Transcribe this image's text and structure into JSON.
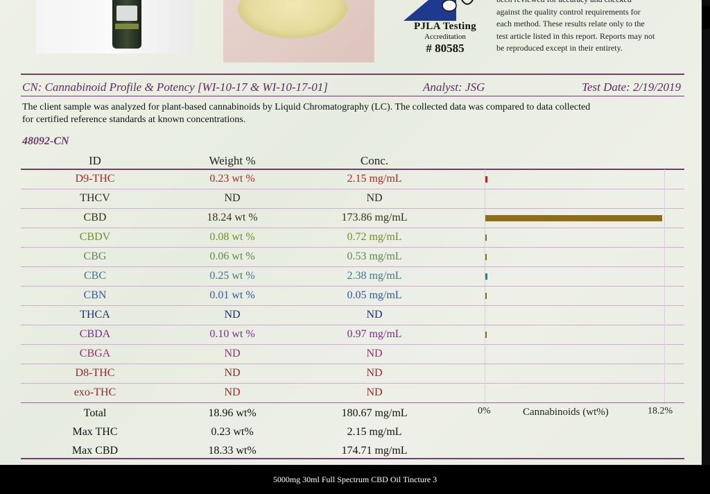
{
  "accreditation": {
    "lab": "PJLA Testing",
    "label": "Accreditation",
    "number": "# 80585"
  },
  "disclaimer": {
    "lines": [
      "been reviewed for accuracy and checked",
      "against the quality control requirements for",
      "each method. These results relate only to the",
      "test article listed in this report. Reports may not",
      "be reproduced except in their entirety."
    ]
  },
  "section": {
    "title": "CN: Cannabinoid Profile & Potency [WI-10-17 & WI-10-17-01]",
    "analyst": "Analyst: JSG",
    "test_date": "Test Date: 2/19/2019"
  },
  "intro": {
    "line1": "The client sample was analyzed for plant-based cannabinoids by Liquid Chromatography (LC). The collected data was compared to data collected",
    "line2": "for certified reference standards at known concentrations."
  },
  "sample_id": "48092-CN",
  "table": {
    "headers": {
      "id": "ID",
      "weight": "Weight %",
      "conc": "Conc."
    },
    "rows": [
      {
        "id": "D9-THC",
        "weight": "0.23 wt %",
        "conc": "2.15 mg/mL",
        "color": "#b3262a"
      },
      {
        "id": "THCV",
        "weight": "ND",
        "conc": "ND",
        "color": "#2b2b2b"
      },
      {
        "id": "CBD",
        "weight": "18.24 wt %",
        "conc": "173.86 mg/mL",
        "color": "#3c3014"
      },
      {
        "id": "CBDV",
        "weight": "0.08 wt %",
        "conc": "0.72 mg/mL",
        "color": "#7a8a2a"
      },
      {
        "id": "CBG",
        "weight": "0.06 wt %",
        "conc": "0.53 mg/mL",
        "color": "#5b8a55"
      },
      {
        "id": "CBC",
        "weight": "0.25 wt %",
        "conc": "2.38 mg/mL",
        "color": "#3f7a86"
      },
      {
        "id": "CBN",
        "weight": "0.01 wt %",
        "conc": "0.05 mg/mL",
        "color": "#2f5b9e"
      },
      {
        "id": "THCA",
        "weight": "ND",
        "conc": "ND",
        "color": "#1f2c7a"
      },
      {
        "id": "CBDA",
        "weight": "0.10 wt %",
        "conc": "0.97 mg/mL",
        "color": "#7a2e8e"
      },
      {
        "id": "CBGA",
        "weight": "ND",
        "conc": "ND",
        "color": "#9a2e6e"
      },
      {
        "id": "D8-THC",
        "weight": "ND",
        "conc": "ND",
        "color": "#9a2535"
      },
      {
        "id": "exo-THC",
        "weight": "ND",
        "conc": "ND",
        "color": "#a0262c"
      }
    ],
    "totals": [
      {
        "id": "Total",
        "weight": "18.96 wt%",
        "conc": "180.67 mg/mL"
      },
      {
        "id": "Max THC",
        "weight": "0.23 wt%",
        "conc": "2.15 mg/mL"
      },
      {
        "id": "Max CBD",
        "weight": "18.33 wt%",
        "conc": "174.71 mg/mL"
      }
    ]
  },
  "chart_data": {
    "type": "bar",
    "orientation": "horizontal",
    "categories": [
      "D9-THC",
      "THCV",
      "CBD",
      "CBDV",
      "CBG",
      "CBC",
      "CBN",
      "THCA",
      "CBDA",
      "CBGA",
      "D8-THC",
      "exo-THC"
    ],
    "values": [
      0.23,
      0,
      18.24,
      0.08,
      0.06,
      0.25,
      0.01,
      0,
      0.1,
      0,
      0,
      0
    ],
    "xlabel": "Cannabinoids (wt%)",
    "xmin_label": "0%",
    "xmax_label": "18.2%",
    "xlim": [
      0,
      18.24
    ],
    "colors": {
      "D9-THC": "#b3262a",
      "CBD": "#8a6e1e",
      "CBC": "#3f7a86"
    }
  },
  "caption": "5000mg 30ml Full Spectrum CBD Oil Tincture 3"
}
